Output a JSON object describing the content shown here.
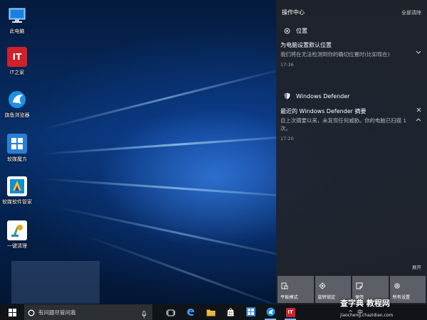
{
  "desktop": {
    "icons": [
      {
        "label": "此电脑",
        "icon": "computer-icon"
      },
      {
        "label": "IT之家",
        "icon": "ithome-icon",
        "glyph": "IT"
      },
      {
        "label": "旗鱼浏览器",
        "icon": "browser-icon"
      },
      {
        "label": "软媒魔方",
        "icon": "rubik-cube-icon"
      },
      {
        "label": "软媒软件管家",
        "icon": "software-manager-icon"
      },
      {
        "label": "一键清理",
        "icon": "cleanup-icon"
      }
    ]
  },
  "action_center": {
    "title": "操作中心",
    "clear_all": "全部清除",
    "groups": [
      {
        "name": "位置",
        "icon": "location-icon",
        "notifications": [
          {
            "title": "为电脑设置默认位置",
            "body": "我们将在无法检测到你的确切位置时(比如现在)",
            "time": "17:36",
            "action_icon": "chevron-down-icon"
          }
        ]
      },
      {
        "name": "Windows Defender",
        "icon": "shield-icon",
        "notifications": [
          {
            "title": "最近的 Windows Defender 摘要",
            "body": "自上次摘要以来，未发现任何威胁。你的电脑已扫描 1 次。",
            "time": "17:20",
            "action_icon": "chevron-up-icon",
            "dismiss_icon": "close-icon"
          }
        ]
      }
    ],
    "expand_label": "展开",
    "quick_actions": [
      {
        "label": "平板模式",
        "icon": "tablet-mode-icon"
      },
      {
        "label": "旋转锁定",
        "icon": "rotation-lock-icon"
      },
      {
        "label": "便签",
        "icon": "note-icon"
      },
      {
        "label": "所有设置",
        "icon": "settings-gear-icon"
      }
    ]
  },
  "taskbar": {
    "search_placeholder": "有问题尽管问我",
    "pinned": [
      {
        "name": "task-view",
        "icon": "task-view-icon"
      },
      {
        "name": "edge",
        "icon": "edge-icon"
      },
      {
        "name": "file-explorer",
        "icon": "folder-icon"
      },
      {
        "name": "store",
        "icon": "store-icon"
      },
      {
        "name": "rubik-cube",
        "icon": "rubik-cube-icon"
      },
      {
        "name": "browser",
        "icon": "browser-icon"
      },
      {
        "name": "ithome",
        "icon": "ithome-icon",
        "glyph": "IT"
      }
    ],
    "tray": {
      "chevron": "^",
      "ime": "中"
    }
  },
  "watermark": {
    "text": "查字典 教程网",
    "url": "jiaocheng.chazidian.com"
  },
  "colors": {
    "accent": "#2a7fd4",
    "action_center_bg": "#202428",
    "tile_bg": "#5c6066",
    "taskbar_bg": "#101418",
    "ithome_red": "#d0202a"
  }
}
